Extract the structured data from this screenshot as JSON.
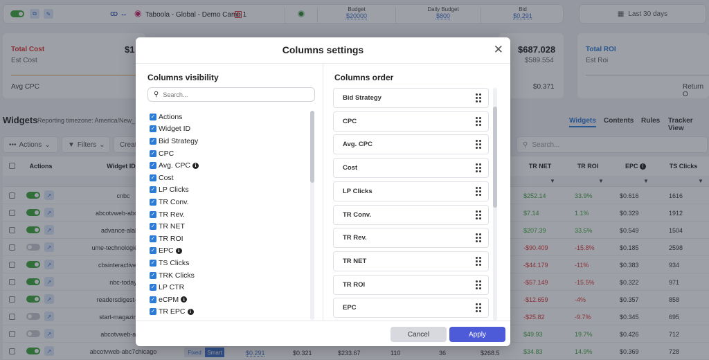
{
  "topbar": {
    "campaign_name": "Taboola - Global - Demo Camp 1",
    "badge": "B",
    "budget_label": "Budget",
    "budget_value": "$20000",
    "daily_budget_label": "Daily Budget",
    "daily_budget_value": "$800",
    "bid_label": "Bid",
    "bid_value": "$0.291",
    "date_range": "Last 30 days"
  },
  "summary": {
    "total_cost_label": "Total Cost",
    "total_cost_value": "$1",
    "est_cost_label": "Est Cost",
    "avg_cpc_label": "Avg CPC",
    "right_big_value": "$687.028",
    "right_sub_value": "$589.554",
    "right_small_value": "$0.371",
    "total_roi_label": "Total ROI",
    "est_roi_label": "Est Roi",
    "return_label": "Return O"
  },
  "widgets_section": {
    "title": "Widgets",
    "timezone": "Reporting timezone: America/New_Y",
    "tabs": [
      "Widgets",
      "Contents",
      "Rules",
      "Tracker View"
    ],
    "actions_label": "Actions",
    "filters_label": "Filters",
    "create_label": "Creat",
    "search_placeholder": "Search..."
  },
  "grid": {
    "headers": {
      "actions": "Actions",
      "widget_id": "Widget ID",
      "tr_net": "TR NET",
      "tr_roi": "TR ROI",
      "epc": "EPC",
      "ts_clicks": "TS Clicks"
    },
    "rows": [
      {
        "on": true,
        "widget": "cnbc",
        "net": "$252.14",
        "roi": "33.9%",
        "epc": "$0.616",
        "clicks": "1616"
      },
      {
        "on": true,
        "widget": "abcotvweb-abc13hc",
        "net": "$7.14",
        "roi": "1.1%",
        "epc": "$0.329",
        "clicks": "1912"
      },
      {
        "on": true,
        "widget": "advance-alaban",
        "net": "$207.39",
        "roi": "33.6%",
        "epc": "$0.549",
        "clicks": "1504"
      },
      {
        "on": false,
        "widget": "ume-technologies-notif",
        "net": "-$90.409",
        "roi": "-15.8%",
        "epc": "$0.185",
        "clicks": "2598"
      },
      {
        "on": true,
        "widget": "cbsinteractive-cbs",
        "net": "-$44.179",
        "roi": "-11%",
        "epc": "$0.383",
        "clicks": "934"
      },
      {
        "on": true,
        "widget": "nbc-today",
        "net": "-$57.149",
        "roi": "-15.5%",
        "epc": "$0.322",
        "clicks": "971"
      },
      {
        "on": true,
        "widget": "readersdigest-taste",
        "net": "-$12.659",
        "roi": "-4%",
        "epc": "$0.357",
        "clicks": "858"
      },
      {
        "on": false,
        "widget": "start-magazine-gl",
        "net": "-$25.82",
        "roi": "-9.7%",
        "epc": "$0.345",
        "clicks": "695"
      },
      {
        "on": false,
        "widget": "abcotvweb-abc7",
        "net": "$49.93",
        "roi": "19.7%",
        "epc": "$0.426",
        "clicks": "712"
      },
      {
        "on": true,
        "widget": "abcotvweb-abc7chicago",
        "net": "$34.83",
        "roi": "14.9%",
        "epc": "$0.369",
        "clicks": "728"
      }
    ],
    "last_row_extra": {
      "fixed": "Fixed",
      "smart": "Smart",
      "bid": "$0.291",
      "c1": "$0.321",
      "c2": "$233.67",
      "c3": "110",
      "c4": "36",
      "c5": "$268.5"
    }
  },
  "modal": {
    "title": "Columns settings",
    "visibility_title": "Columns visibility",
    "order_title": "Columns order",
    "search_placeholder": "Search...",
    "visibility_items": [
      {
        "label": "Actions",
        "info": false
      },
      {
        "label": "Widget ID",
        "info": false
      },
      {
        "label": "Bid Strategy",
        "info": false
      },
      {
        "label": "CPC",
        "info": false
      },
      {
        "label": "Avg. CPC",
        "info": true
      },
      {
        "label": "Cost",
        "info": false
      },
      {
        "label": "LP Clicks",
        "info": false
      },
      {
        "label": "TR Conv.",
        "info": false
      },
      {
        "label": "TR Rev.",
        "info": false
      },
      {
        "label": "TR NET",
        "info": false
      },
      {
        "label": "TR ROI",
        "info": false
      },
      {
        "label": "EPC",
        "info": true
      },
      {
        "label": "TS Clicks",
        "info": false
      },
      {
        "label": "TRK Clicks",
        "info": false
      },
      {
        "label": "LP CTR",
        "info": false
      },
      {
        "label": "eCPM",
        "info": true
      },
      {
        "label": "TR EPC",
        "info": true
      }
    ],
    "order_items": [
      "Bid Strategy",
      "CPC",
      "Avg. CPC",
      "Cost",
      "LP Clicks",
      "TR Conv.",
      "TR Rev.",
      "TR NET",
      "TR ROI",
      "EPC"
    ],
    "cancel_label": "Cancel",
    "apply_label": "Apply"
  }
}
